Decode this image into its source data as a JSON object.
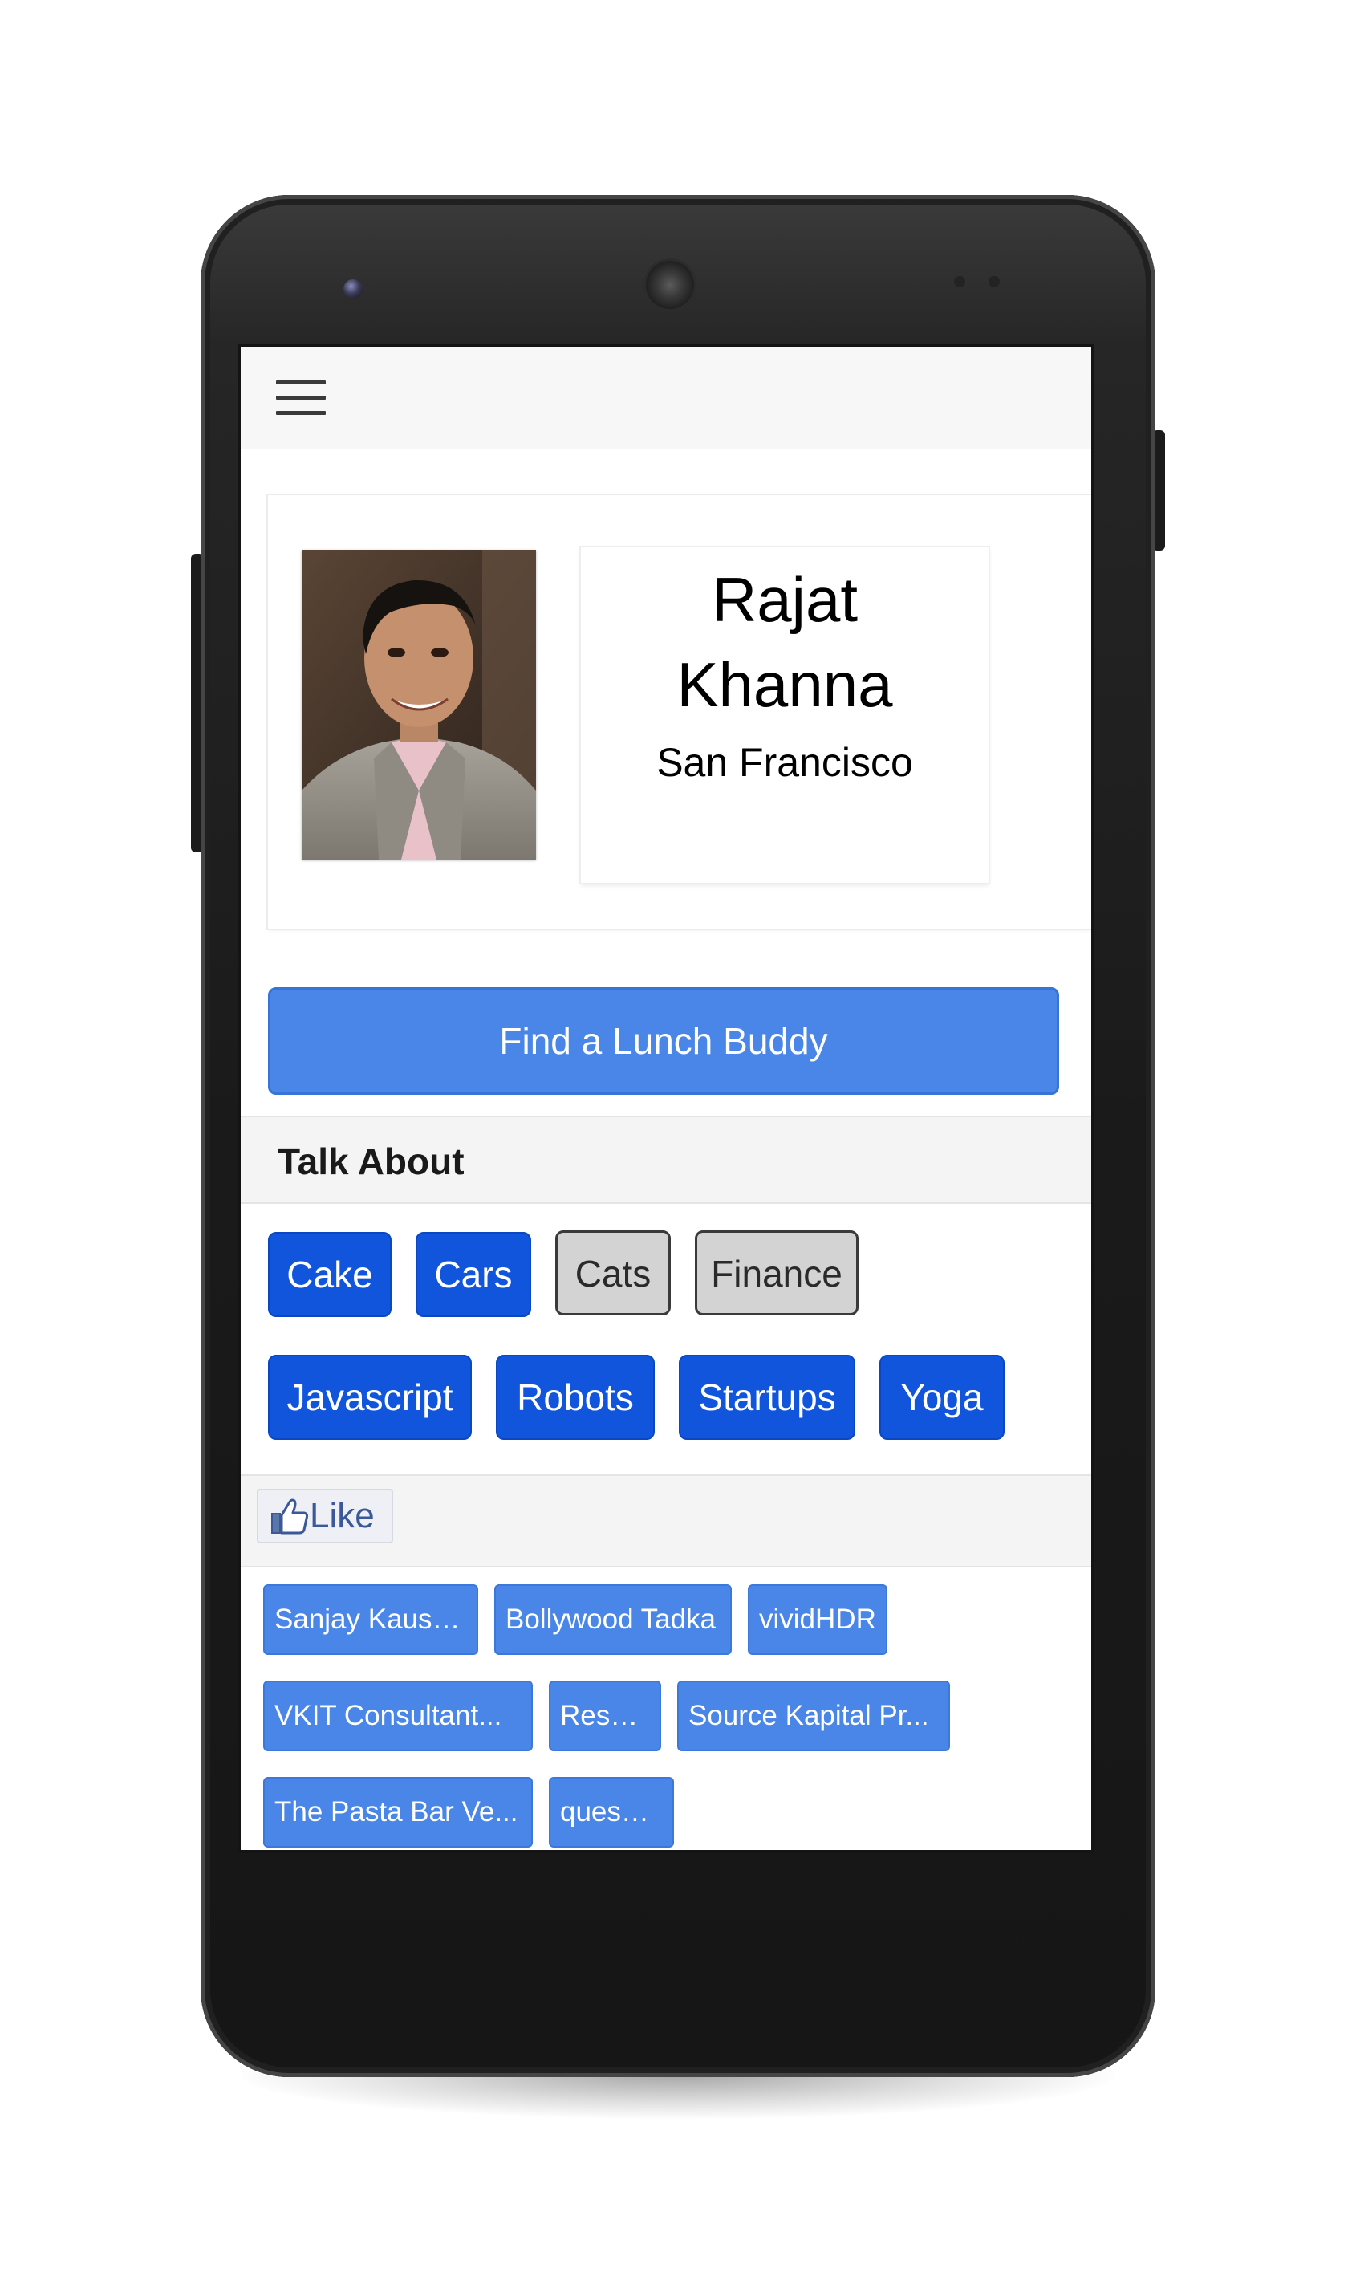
{
  "device": {
    "frame_color": "#1a1a1a",
    "icons": {
      "camera": "front-camera-icon",
      "speaker": "earpiece-speaker-icon"
    }
  },
  "app_bar": {
    "menu_icon": "hamburger-menu-icon"
  },
  "profile": {
    "first_name": "Rajat",
    "last_name": "Khanna",
    "city": "San Francisco"
  },
  "primary_action": {
    "label": "Find a Lunch Buddy",
    "color": "#4a86e8"
  },
  "talk_about": {
    "heading": "Talk About",
    "active_color": "#1155dd",
    "inactive_color": "#d3d3d3",
    "tags": [
      {
        "label": "Cake",
        "selected": true
      },
      {
        "label": "Cars",
        "selected": true
      },
      {
        "label": "Cats",
        "selected": false
      },
      {
        "label": "Finance",
        "selected": false
      },
      {
        "label": "Javascript",
        "selected": true
      },
      {
        "label": "Robots",
        "selected": true
      },
      {
        "label": "Startups",
        "selected": true
      },
      {
        "label": "Yoga",
        "selected": true
      }
    ]
  },
  "likes": {
    "button_label": "Like",
    "button_icon": "thumbs-up-icon",
    "chip_color": "#4a86e8",
    "pages": [
      "Sanjay Kaushik",
      "Bollywood Tadka",
      "vividHDR",
      "VKIT Consultant...",
      "Resaiki",
      "Source Kapital Pr...",
      "The Pasta Bar Ve...",
      "queskey"
    ]
  }
}
